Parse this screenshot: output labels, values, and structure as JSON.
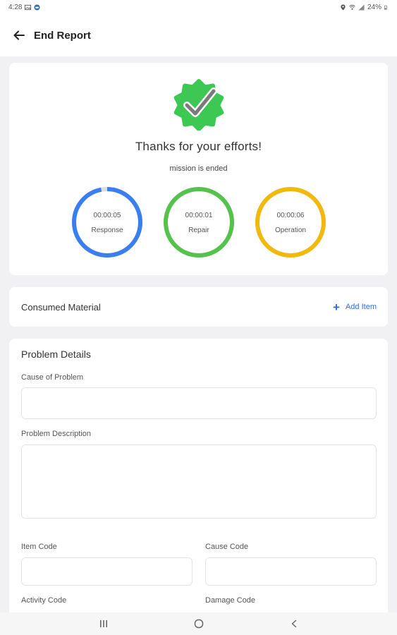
{
  "status_bar": {
    "time": "4:28",
    "battery": "24%"
  },
  "header": {
    "title": "End Report"
  },
  "summary": {
    "message": "Thanks for your efforts!",
    "subtitle": "mission is ended",
    "timers": [
      {
        "time": "00:00:05",
        "label": "Response",
        "color": "#3a7ff0",
        "progress": 0.97
      },
      {
        "time": "00:00:01",
        "label": "Repair",
        "color": "#55c24c",
        "progress": 1.0
      },
      {
        "time": "00:00:06",
        "label": "Operation",
        "color": "#f2b90d",
        "progress": 1.0
      }
    ]
  },
  "consumed_material": {
    "title": "Consumed Material",
    "add_label": "Add Item"
  },
  "problem_details": {
    "title": "Problem Details",
    "cause_of_problem": {
      "label": "Cause of Problem",
      "value": ""
    },
    "problem_description": {
      "label": "Problem Description",
      "value": ""
    },
    "item_code": {
      "label": "Item Code",
      "value": ""
    },
    "cause_code": {
      "label": "Cause Code",
      "value": ""
    },
    "activity_code": {
      "label": "Activity Code"
    },
    "damage_code": {
      "label": "Damage Code"
    }
  },
  "colors": {
    "accent_blue": "#2f6fd6",
    "badge_green": "#3cc853"
  },
  "icons": [
    "back-arrow-icon",
    "verified-badge-icon",
    "plus-icon",
    "recents-icon",
    "home-icon",
    "nav-back-icon"
  ]
}
